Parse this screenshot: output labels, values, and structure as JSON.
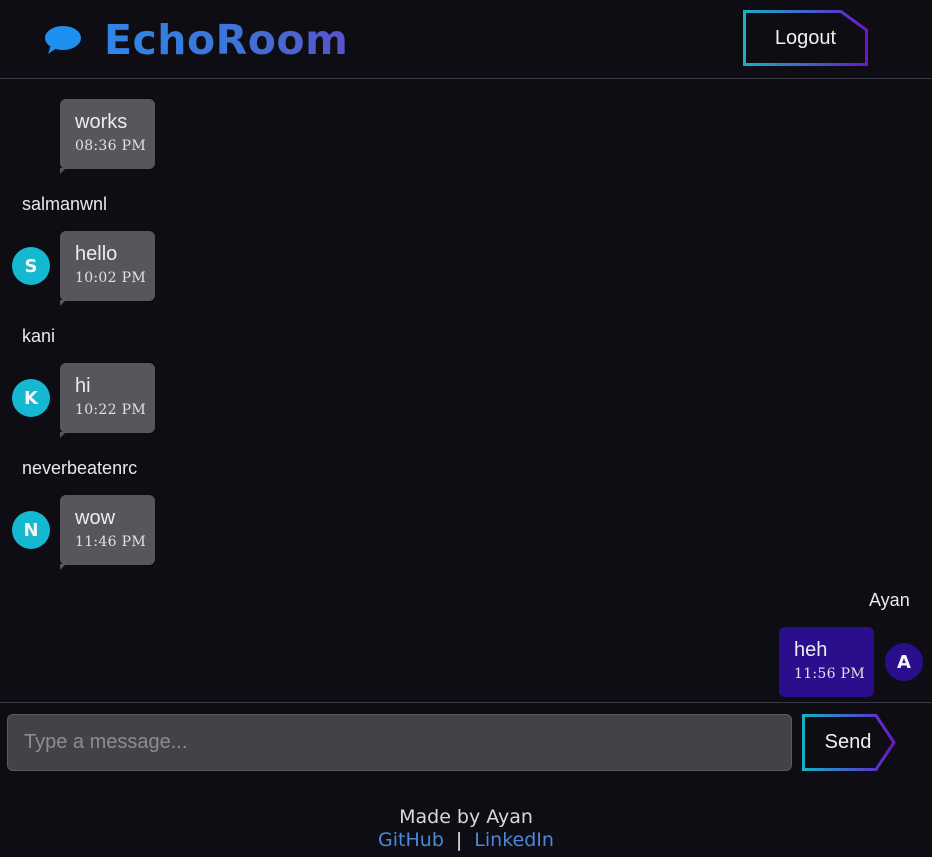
{
  "header": {
    "title": "EchoRoom",
    "logo_icon": "chat-bubble-icon",
    "logout_label": "Logout"
  },
  "messages": [
    {
      "username": "",
      "avatar": "",
      "text": "works",
      "time": "08:36 PM"
    },
    {
      "username": "salmanwnl",
      "avatar": "S",
      "text": "hello",
      "time": "10:02 PM"
    },
    {
      "username": "kani",
      "avatar": "K",
      "text": "hi",
      "time": "10:22 PM"
    },
    {
      "username": "neverbeatenrc",
      "avatar": "N",
      "text": "wow",
      "time": "11:46 PM"
    },
    {
      "username": "Ayan",
      "avatar": "A",
      "text": "heh",
      "time": "11:56 PM",
      "mine": true
    }
  ],
  "composer": {
    "placeholder": "Type a message...",
    "value": "",
    "send_label": "Send"
  },
  "footer": {
    "made_by": "Made by Ayan",
    "github": "GitHub",
    "separator": "|",
    "linkedin": "LinkedIn"
  },
  "colors": {
    "background": "#0e0d14",
    "other_bubble": "#57565c",
    "my_bubble": "#2a0e8c",
    "avatar": "#14b8d0",
    "brand_blue": "#2f86e8",
    "link": "#4a88d8"
  }
}
